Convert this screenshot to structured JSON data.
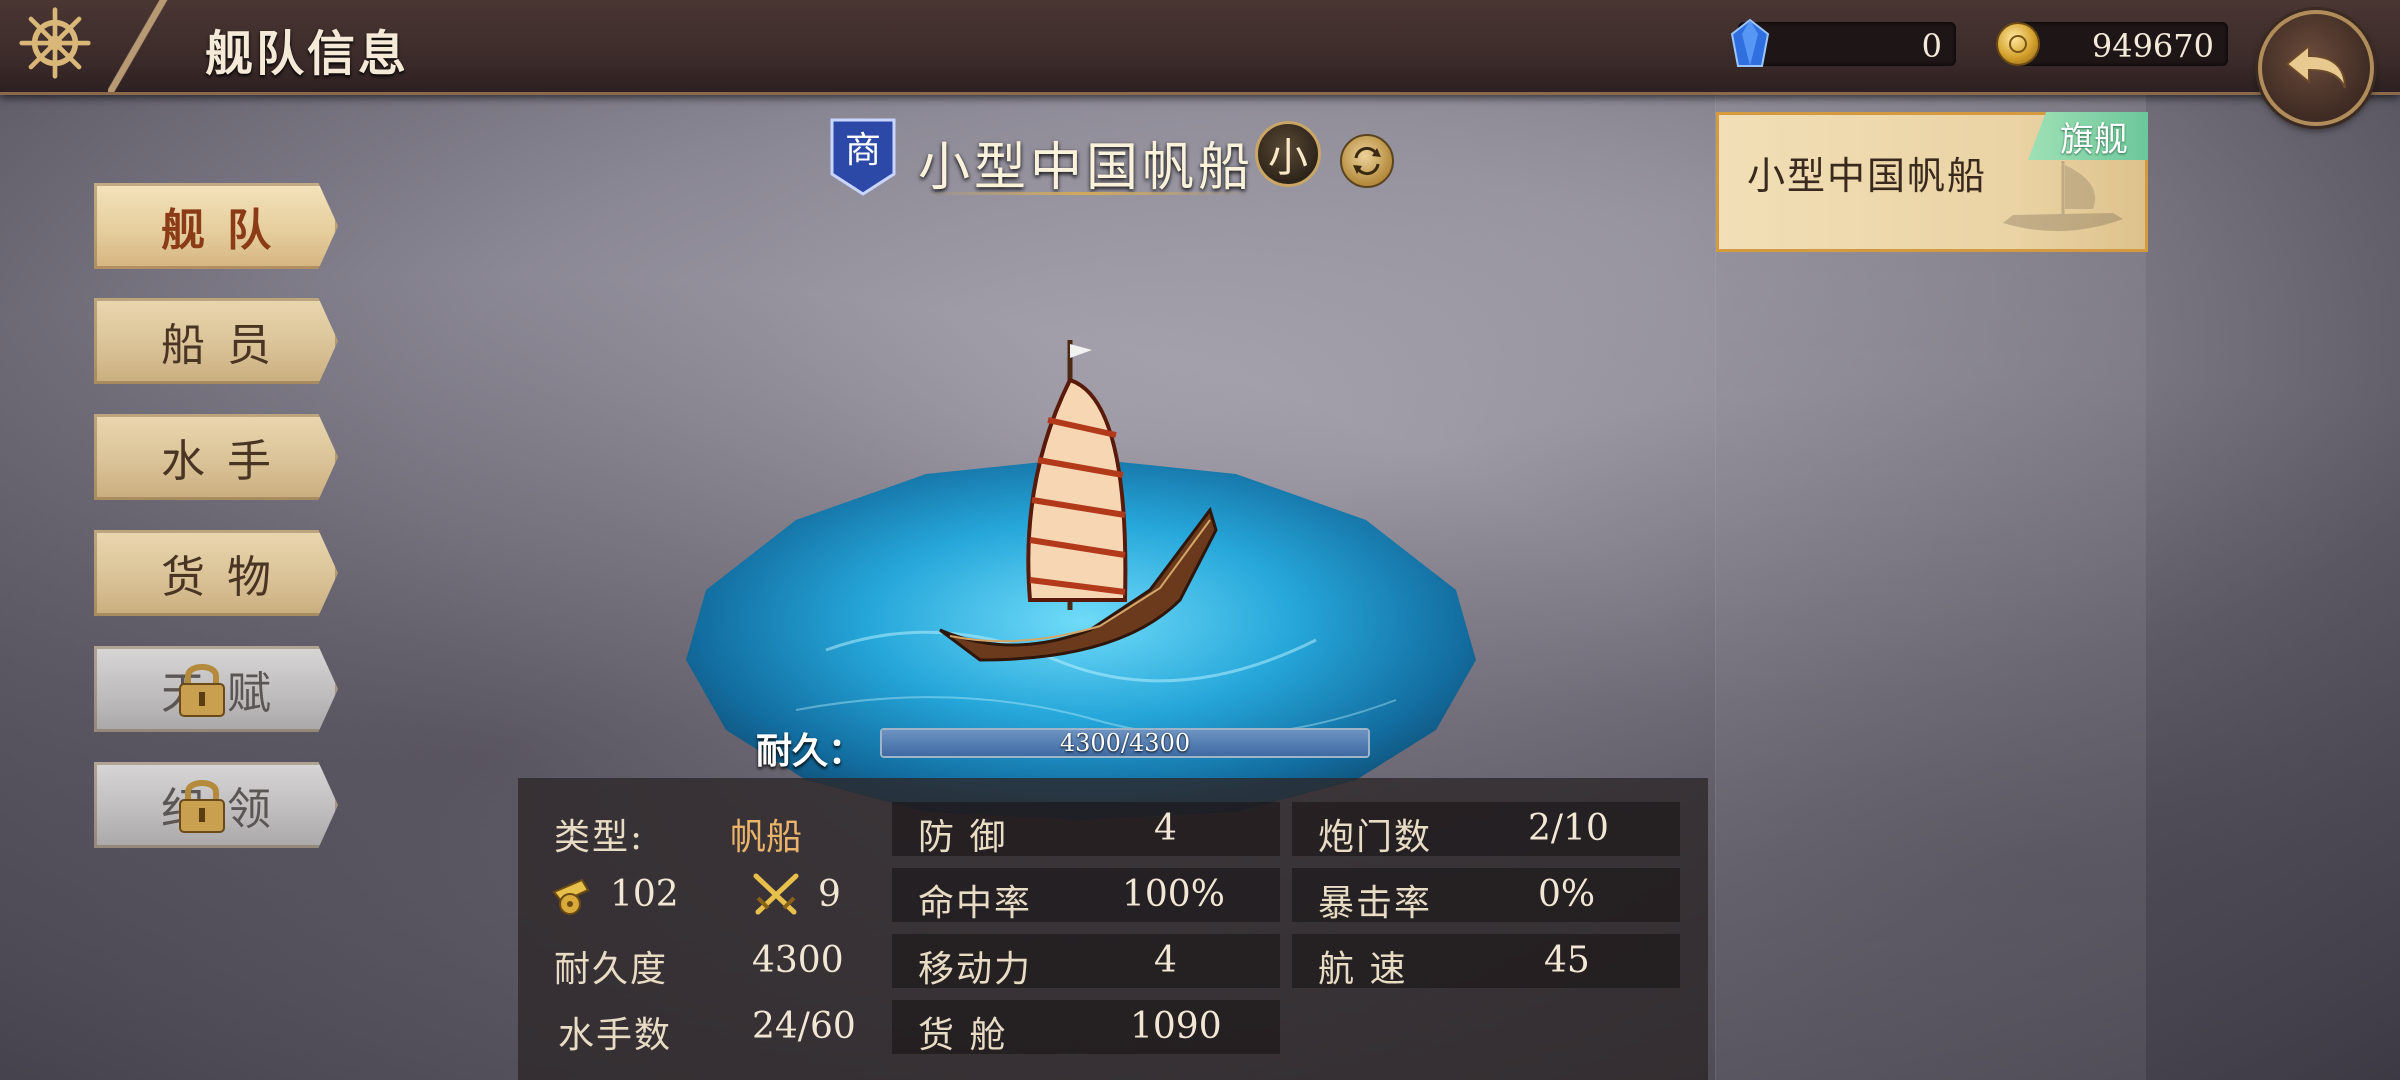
{
  "header": {
    "title": "舰队信息",
    "gems": "0",
    "gold": "949670"
  },
  "menu": [
    {
      "label": "舰队",
      "state": "active"
    },
    {
      "label": "船员",
      "state": "normal"
    },
    {
      "label": "水手",
      "state": "normal"
    },
    {
      "label": "货物",
      "state": "normal"
    },
    {
      "label": "天赋",
      "state": "locked"
    },
    {
      "label": "纪领",
      "state": "locked"
    }
  ],
  "ship": {
    "class_badge": "商",
    "name": "小型中国帆船",
    "size_badge": "小",
    "durability_label": "耐久：",
    "durability_text": "4300/4300",
    "durability_fraction": 1.0
  },
  "flagship_card": {
    "name": "小型中国帆船",
    "tag": "旗舰"
  },
  "stats": {
    "type_label": "类型:",
    "type_value": "帆船",
    "cannon_value": "102",
    "attack_value": "9",
    "durability_label": "耐久度",
    "durability_value": "4300",
    "sailors_label": "水手数",
    "sailors_value": "24/60",
    "defense_label": "防 御",
    "defense_value": "4",
    "hit_label": "命中率",
    "hit_value": "100%",
    "move_label": "移动力",
    "move_value": "4",
    "cargo_label": "货 舱",
    "cargo_value": "1090",
    "gunport_label": "炮门数",
    "gunport_value": "2/10",
    "crit_label": "暴击率",
    "crit_value": "0%",
    "speed_label": "航 速",
    "speed_value": "45"
  },
  "colors": {
    "accent_gold": "#eab46a",
    "flag_tag": "#6cc79a",
    "durability_fill": "#3e6aa2"
  },
  "icons": [
    "ship-wheel-icon",
    "gem-icon",
    "coin-icon",
    "back-arrow-icon",
    "lock-icon",
    "swap-icon",
    "cannon-icon",
    "crossed-swords-icon"
  ]
}
